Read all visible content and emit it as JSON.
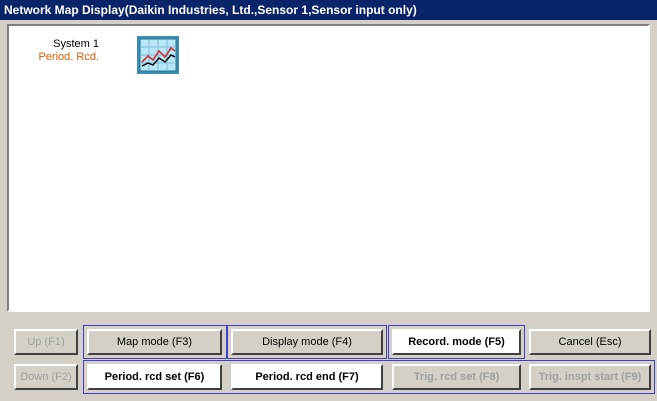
{
  "window": {
    "title": "Network Map Display(Daikin Industries, Ltd.,Sensor 1,Sensor input only)"
  },
  "map": {
    "node": {
      "name": "System 1",
      "status": "Period. Rcd.",
      "status_color": "#e05a00",
      "icon": "chart-icon"
    }
  },
  "buttons": {
    "up": "Up (F1)",
    "down": "Down (F2)",
    "map_mode": "Map mode (F3)",
    "display_mode": "Display mode (F4)",
    "record_mode": "Record. mode (F5)",
    "cancel": "Cancel (Esc)",
    "period_rcd_set": "Period. rcd set (F6)",
    "period_rcd_end": "Period. rcd end (F7)",
    "trig_rcd_set": "Trig. rcd set (F8)",
    "trig_inspt_start": "Trig. inspt start (F9)"
  },
  "colors": {
    "titlebar": "#0a246a",
    "face": "#d4d0c8",
    "group_border": "#4040c8"
  }
}
